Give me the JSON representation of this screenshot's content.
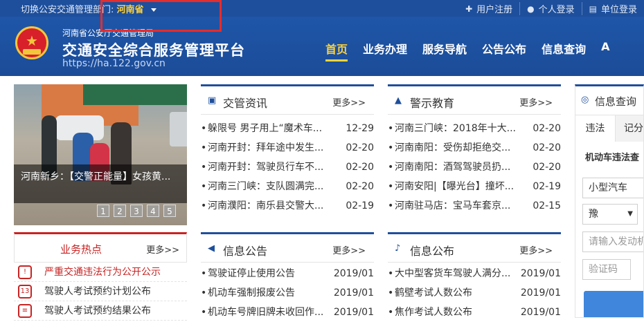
{
  "topbar": {
    "switch_label": "切换公安交通管理部门:",
    "province": "河南省",
    "links": [
      {
        "label": "用户注册",
        "icon": "plus-icon"
      },
      {
        "label": "个人登录",
        "icon": "user-icon"
      },
      {
        "label": "单位登录",
        "icon": "building-icon"
      }
    ]
  },
  "header": {
    "org": "河南省公安厅交通管理局",
    "platform": "交通安全综合服务管理平台",
    "url": "https://ha.122.gov.cn",
    "nav": [
      "首页",
      "业务办理",
      "服务导航",
      "公告公布",
      "信息查询",
      "A"
    ]
  },
  "slide": {
    "caption": "河南新乡：【交警正能量】女孩黄...",
    "pages": [
      "1",
      "2",
      "3",
      "4",
      "5"
    ]
  },
  "hot": {
    "title": "业务热点",
    "more": "更多>>",
    "items": [
      "严重交通违法行为公开公示",
      "驾驶人考试预约计划公布",
      "驾驶人考试预约结果公布"
    ]
  },
  "news": {
    "title": "交管资讯",
    "more": "更多>>",
    "items": [
      {
        "t": "躲限号 男子用上“魔术车...",
        "d": "12-29"
      },
      {
        "t": "河南开封：拜年途中发生...",
        "d": "02-20"
      },
      {
        "t": "河南开封：驾驶员行车不...",
        "d": "02-20"
      },
      {
        "t": "河南三门峡：支队圆满完...",
        "d": "02-20"
      },
      {
        "t": "河南濮阳：南乐县交警大...",
        "d": "02-19"
      }
    ]
  },
  "warn": {
    "title": "警示教育",
    "more": "更多>>",
    "items": [
      {
        "t": "河南三门峡：2018年十大...",
        "d": "02-20"
      },
      {
        "t": "河南南阳：受伤却拒绝交...",
        "d": "02-20"
      },
      {
        "t": "河南南阳：酒驾驾驶员扔...",
        "d": "02-20"
      },
      {
        "t": "河南安阳|【曝光台】撞坏...",
        "d": "02-19"
      },
      {
        "t": "河南驻马店：宝马车套京...",
        "d": "02-15"
      }
    ]
  },
  "notice": {
    "title": "信息公告",
    "more": "更多>>",
    "items": [
      {
        "t": "驾驶证停止使用公告",
        "d": "2019/01"
      },
      {
        "t": "机动车强制报废公告",
        "d": "2019/01"
      },
      {
        "t": "机动车号牌旧牌未收回作...",
        "d": "2019/01"
      }
    ]
  },
  "publish": {
    "title": "信息公布",
    "more": "更多>>",
    "items": [
      {
        "t": "大中型客货车驾驶人满分...",
        "d": "2019/01"
      },
      {
        "t": "鹤壁考试人数公布",
        "d": "2019/01"
      },
      {
        "t": "焦作考试人数公布",
        "d": "2019/01"
      }
    ]
  },
  "query": {
    "title": "信息查询",
    "tabs": [
      "违法",
      "记分"
    ],
    "subtitle": "机动车违法查",
    "vehicle_type": "小型汽车",
    "plate_prefix": "豫",
    "engine_placeholder": "请输入发动机",
    "captcha_placeholder": "验证码"
  }
}
